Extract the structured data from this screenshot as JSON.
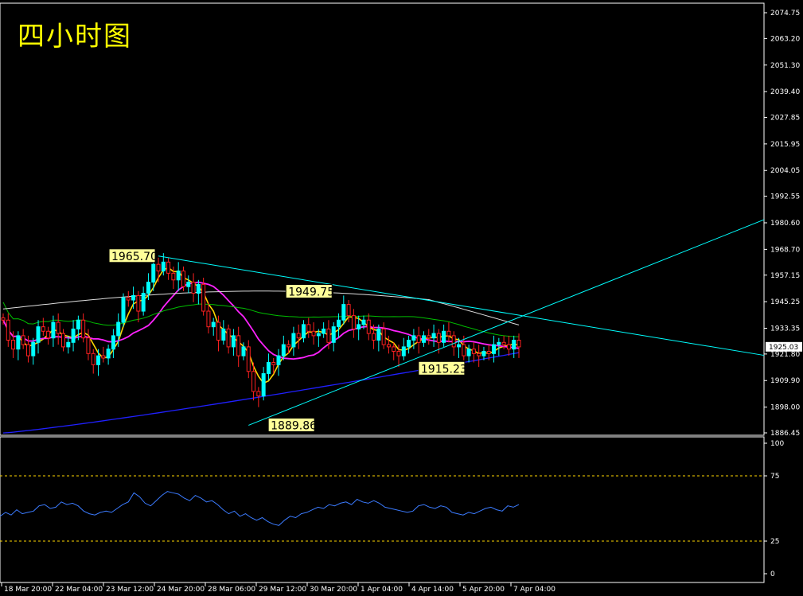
{
  "header": {
    "title": "四小时图"
  },
  "chart_data": {
    "type": "candlestick",
    "title": "四小时图",
    "price_axis": {
      "min": 1886.45,
      "max": 2074.75,
      "ticks": [
        "2074.75",
        "2063.20",
        "2051.30",
        "2039.40",
        "2027.85",
        "2015.95",
        "2004.05",
        "1992.55",
        "1980.60",
        "1968.70",
        "1957.15",
        "1945.25",
        "1933.35",
        "1921.80",
        "1909.90",
        "1898.00",
        "1886.45"
      ],
      "current_price": "1925.03"
    },
    "time_axis": [
      "18 Mar 20:00",
      "22 Mar 04:00",
      "23 Mar 12:00",
      "24 Mar 20:00",
      "28 Mar 06:00",
      "29 Mar 12:00",
      "30 Mar 20:00",
      "1 Apr 04:00",
      "4 Apr 14:00",
      "5 Apr 20:00",
      "7 Apr 04:00"
    ],
    "annotations": [
      {
        "label": "1965.70",
        "value": 1965.7
      },
      {
        "label": "1949.75",
        "value": 1949.75
      },
      {
        "label": "1915.23",
        "value": 1915.23
      },
      {
        "label": "1889.86",
        "value": 1889.86
      }
    ],
    "close_series": [
      1937,
      1928,
      1924,
      1930,
      1926,
      1921,
      1927,
      1934,
      1932,
      1929,
      1936,
      1931,
      1925,
      1927,
      1933,
      1937,
      1929,
      1922,
      1917,
      1921,
      1920,
      1924,
      1930,
      1936,
      1947,
      1946,
      1948,
      1941,
      1949,
      1954,
      1962,
      1959,
      1963,
      1958,
      1955,
      1959,
      1952,
      1954,
      1949,
      1953,
      1941,
      1934,
      1936,
      1928,
      1933,
      1925,
      1930,
      1921,
      1925,
      1914,
      1905,
      1903,
      1913,
      1918,
      1917,
      1921,
      1926,
      1925,
      1931,
      1929,
      1935,
      1932,
      1930,
      1931,
      1933,
      1927,
      1934,
      1937,
      1944,
      1939,
      1933,
      1935,
      1937,
      1931,
      1928,
      1933,
      1926,
      1925,
      1923,
      1921,
      1925,
      1928,
      1930,
      1927,
      1930,
      1929,
      1931,
      1927,
      1932,
      1930,
      1925,
      1926,
      1921,
      1924,
      1922,
      1921,
      1923,
      1922,
      1926,
      1927,
      1926,
      1924,
      1928,
      1925
    ],
    "indicator": {
      "name": "oscillator",
      "levels": [
        100,
        75,
        25,
        0
      ],
      "values": [
        44,
        47,
        45,
        49,
        46,
        47,
        48,
        52,
        53,
        50,
        51,
        55,
        53,
        54,
        52,
        48,
        46,
        45,
        47,
        48,
        47,
        50,
        53,
        55,
        62,
        59,
        54,
        52,
        56,
        60,
        63,
        62,
        61,
        58,
        56,
        60,
        58,
        55,
        56,
        53,
        49,
        46,
        48,
        44,
        46,
        43,
        41,
        43,
        40,
        38,
        37,
        41,
        44,
        43,
        46,
        47,
        49,
        51,
        50,
        53,
        52,
        54,
        55,
        53,
        57,
        55,
        54,
        56,
        54,
        51,
        50,
        49,
        48,
        47,
        48,
        52,
        53,
        51,
        50,
        52,
        51,
        47,
        46,
        45,
        47,
        46,
        48,
        50,
        51,
        49,
        48,
        52,
        51,
        53
      ]
    }
  }
}
